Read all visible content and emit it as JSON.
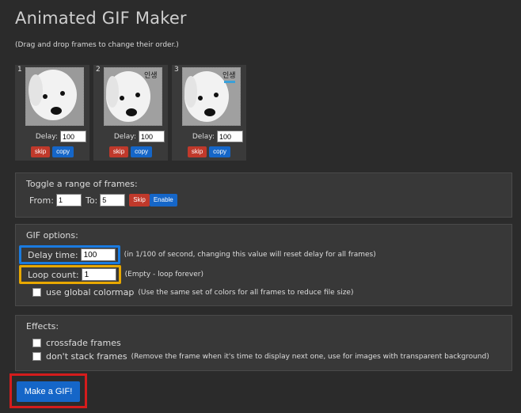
{
  "header": {
    "title": "Animated GIF Maker",
    "hint": "(Drag and drop frames to change their order.)"
  },
  "frames": [
    {
      "number": "1",
      "delay_label": "Delay:",
      "delay_value": "100",
      "skip_label": "skip",
      "copy_label": "copy",
      "overlay_text": ""
    },
    {
      "number": "2",
      "delay_label": "Delay:",
      "delay_value": "100",
      "skip_label": "skip",
      "copy_label": "copy",
      "overlay_text": "인생"
    },
    {
      "number": "3",
      "delay_label": "Delay:",
      "delay_value": "100",
      "skip_label": "skip",
      "copy_label": "copy",
      "overlay_text": "인생"
    }
  ],
  "toggle_range": {
    "title": "Toggle a range of frames:",
    "from_label": "From:",
    "from_value": "1",
    "to_label": "To:",
    "to_value": "5",
    "skip_label": "Skip",
    "enable_label": "Enable"
  },
  "gif_options": {
    "title": "GIF options:",
    "delay_label": "Delay time:",
    "delay_value": "100",
    "delay_note": "(in 1/100 of second, changing this value will reset delay for all frames)",
    "loop_label": "Loop count:",
    "loop_value": "1",
    "loop_note": "(Empty - loop forever)",
    "colormap_label": "use global colormap",
    "colormap_note": "(Use the same set of colors for all frames to reduce file size)"
  },
  "effects": {
    "title": "Effects:",
    "crossfade_label": "crossfade frames",
    "nostack_label": "don't stack frames",
    "nostack_note": "(Remove the frame when it's time to display next one, use for images with transparent background)"
  },
  "make_button": {
    "label": "Make a GIF!"
  },
  "colors": {
    "blue": "#1566c8",
    "red": "#c0392b",
    "highlight_blue": "#1a7be0",
    "highlight_yellow": "#e8a800",
    "highlight_red": "#d51c1c"
  }
}
